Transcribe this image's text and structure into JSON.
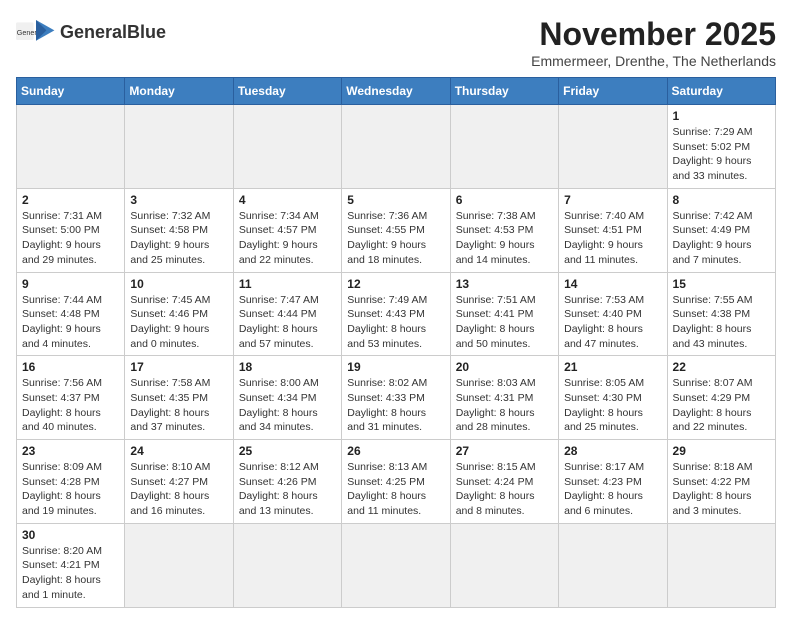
{
  "header": {
    "logo_text_normal": "General",
    "logo_text_bold": "Blue",
    "month_title": "November 2025",
    "subtitle": "Emmermeer, Drenthe, The Netherlands"
  },
  "calendar": {
    "days_of_week": [
      "Sunday",
      "Monday",
      "Tuesday",
      "Wednesday",
      "Thursday",
      "Friday",
      "Saturday"
    ],
    "weeks": [
      [
        {
          "day": "",
          "empty": true
        },
        {
          "day": "",
          "empty": true
        },
        {
          "day": "",
          "empty": true
        },
        {
          "day": "",
          "empty": true
        },
        {
          "day": "",
          "empty": true
        },
        {
          "day": "",
          "empty": true
        },
        {
          "day": "1",
          "info": "Sunrise: 7:29 AM\nSunset: 5:02 PM\nDaylight: 9 hours\nand 33 minutes."
        }
      ],
      [
        {
          "day": "2",
          "info": "Sunrise: 7:31 AM\nSunset: 5:00 PM\nDaylight: 9 hours\nand 29 minutes."
        },
        {
          "day": "3",
          "info": "Sunrise: 7:32 AM\nSunset: 4:58 PM\nDaylight: 9 hours\nand 25 minutes."
        },
        {
          "day": "4",
          "info": "Sunrise: 7:34 AM\nSunset: 4:57 PM\nDaylight: 9 hours\nand 22 minutes."
        },
        {
          "day": "5",
          "info": "Sunrise: 7:36 AM\nSunset: 4:55 PM\nDaylight: 9 hours\nand 18 minutes."
        },
        {
          "day": "6",
          "info": "Sunrise: 7:38 AM\nSunset: 4:53 PM\nDaylight: 9 hours\nand 14 minutes."
        },
        {
          "day": "7",
          "info": "Sunrise: 7:40 AM\nSunset: 4:51 PM\nDaylight: 9 hours\nand 11 minutes."
        },
        {
          "day": "8",
          "info": "Sunrise: 7:42 AM\nSunset: 4:49 PM\nDaylight: 9 hours\nand 7 minutes."
        }
      ],
      [
        {
          "day": "9",
          "info": "Sunrise: 7:44 AM\nSunset: 4:48 PM\nDaylight: 9 hours\nand 4 minutes."
        },
        {
          "day": "10",
          "info": "Sunrise: 7:45 AM\nSunset: 4:46 PM\nDaylight: 9 hours\nand 0 minutes."
        },
        {
          "day": "11",
          "info": "Sunrise: 7:47 AM\nSunset: 4:44 PM\nDaylight: 8 hours\nand 57 minutes."
        },
        {
          "day": "12",
          "info": "Sunrise: 7:49 AM\nSunset: 4:43 PM\nDaylight: 8 hours\nand 53 minutes."
        },
        {
          "day": "13",
          "info": "Sunrise: 7:51 AM\nSunset: 4:41 PM\nDaylight: 8 hours\nand 50 minutes."
        },
        {
          "day": "14",
          "info": "Sunrise: 7:53 AM\nSunset: 4:40 PM\nDaylight: 8 hours\nand 47 minutes."
        },
        {
          "day": "15",
          "info": "Sunrise: 7:55 AM\nSunset: 4:38 PM\nDaylight: 8 hours\nand 43 minutes."
        }
      ],
      [
        {
          "day": "16",
          "info": "Sunrise: 7:56 AM\nSunset: 4:37 PM\nDaylight: 8 hours\nand 40 minutes."
        },
        {
          "day": "17",
          "info": "Sunrise: 7:58 AM\nSunset: 4:35 PM\nDaylight: 8 hours\nand 37 minutes."
        },
        {
          "day": "18",
          "info": "Sunrise: 8:00 AM\nSunset: 4:34 PM\nDaylight: 8 hours\nand 34 minutes."
        },
        {
          "day": "19",
          "info": "Sunrise: 8:02 AM\nSunset: 4:33 PM\nDaylight: 8 hours\nand 31 minutes."
        },
        {
          "day": "20",
          "info": "Sunrise: 8:03 AM\nSunset: 4:31 PM\nDaylight: 8 hours\nand 28 minutes."
        },
        {
          "day": "21",
          "info": "Sunrise: 8:05 AM\nSunset: 4:30 PM\nDaylight: 8 hours\nand 25 minutes."
        },
        {
          "day": "22",
          "info": "Sunrise: 8:07 AM\nSunset: 4:29 PM\nDaylight: 8 hours\nand 22 minutes."
        }
      ],
      [
        {
          "day": "23",
          "info": "Sunrise: 8:09 AM\nSunset: 4:28 PM\nDaylight: 8 hours\nand 19 minutes."
        },
        {
          "day": "24",
          "info": "Sunrise: 8:10 AM\nSunset: 4:27 PM\nDaylight: 8 hours\nand 16 minutes."
        },
        {
          "day": "25",
          "info": "Sunrise: 8:12 AM\nSunset: 4:26 PM\nDaylight: 8 hours\nand 13 minutes."
        },
        {
          "day": "26",
          "info": "Sunrise: 8:13 AM\nSunset: 4:25 PM\nDaylight: 8 hours\nand 11 minutes."
        },
        {
          "day": "27",
          "info": "Sunrise: 8:15 AM\nSunset: 4:24 PM\nDaylight: 8 hours\nand 8 minutes."
        },
        {
          "day": "28",
          "info": "Sunrise: 8:17 AM\nSunset: 4:23 PM\nDaylight: 8 hours\nand 6 minutes."
        },
        {
          "day": "29",
          "info": "Sunrise: 8:18 AM\nSunset: 4:22 PM\nDaylight: 8 hours\nand 3 minutes."
        }
      ],
      [
        {
          "day": "30",
          "info": "Sunrise: 8:20 AM\nSunset: 4:21 PM\nDaylight: 8 hours\nand 1 minute."
        },
        {
          "day": "",
          "empty": true
        },
        {
          "day": "",
          "empty": true
        },
        {
          "day": "",
          "empty": true
        },
        {
          "day": "",
          "empty": true
        },
        {
          "day": "",
          "empty": true
        },
        {
          "day": "",
          "empty": true
        }
      ]
    ]
  }
}
